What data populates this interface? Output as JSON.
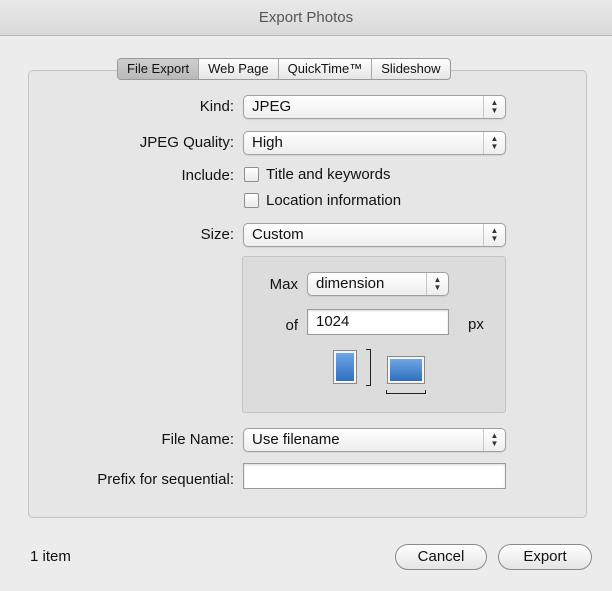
{
  "window": {
    "title": "Export Photos"
  },
  "tabs": [
    {
      "label": "File Export",
      "active": true
    },
    {
      "label": "Web Page",
      "active": false
    },
    {
      "label": "QuickTime™",
      "active": false
    },
    {
      "label": "Slideshow",
      "active": false
    }
  ],
  "form": {
    "kind_label": "Kind:",
    "kind_value": "JPEG",
    "quality_label": "JPEG Quality:",
    "quality_value": "High",
    "include_label": "Include:",
    "include_title": "Title and keywords",
    "include_location": "Location information",
    "size_label": "Size:",
    "size_value": "Custom",
    "max_label": "Max",
    "max_value": "dimension",
    "of_label": "of",
    "of_value": "1024",
    "unit": "px",
    "filename_label": "File Name:",
    "filename_value": "Use filename",
    "prefix_label": "Prefix for sequential:",
    "prefix_value": ""
  },
  "footer": {
    "status": "1 item",
    "cancel_label": "Cancel",
    "export_label": "Export"
  },
  "icons": {
    "popup_arrows": "up-down-arrows-icon",
    "orientation": "portrait-landscape-icon"
  },
  "colors": {
    "orientation_fill": "#3a78c8"
  }
}
